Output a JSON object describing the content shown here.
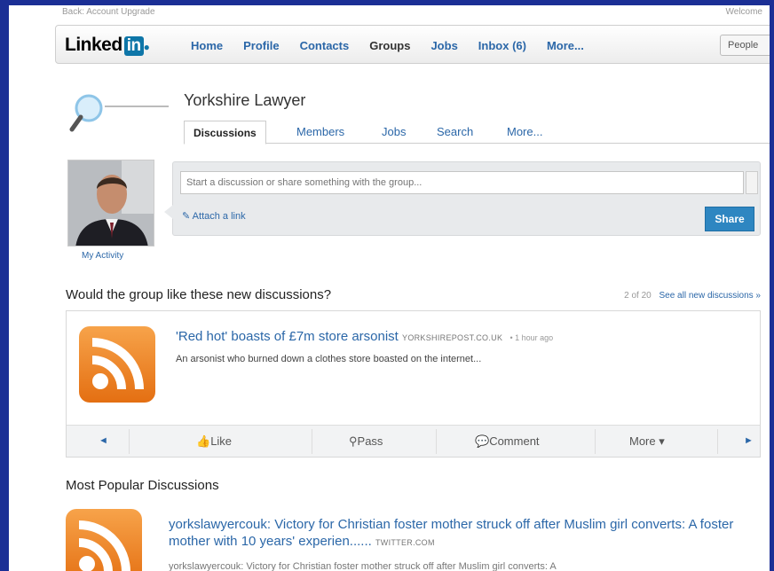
{
  "topbar": {
    "left_text": "Back: Account Upgrade",
    "right_text": "Welcome"
  },
  "nav": {
    "logo_text": "Linked",
    "logo_in": "in",
    "items": [
      "Home",
      "Profile",
      "Contacts",
      "Groups",
      "Jobs",
      "Inbox (6)",
      "More..."
    ],
    "people_button": "People"
  },
  "group": {
    "title": "Yorkshire Lawyer",
    "tabs": [
      "Discussions",
      "Members",
      "Jobs",
      "Search",
      "More..."
    ]
  },
  "composer": {
    "placeholder": "Start a discussion or share something with the group...",
    "attach_label": "Attach a link",
    "share_label": "Share",
    "my_activity": "My Activity"
  },
  "suggestions": {
    "heading": "Would the group like these new discussions?",
    "count": "2 of 20",
    "see_all": "See all new discussions »",
    "item": {
      "title": "'Red hot' boasts of £7m store arsonist",
      "source": "YORKSHIREPOST.CO.UK",
      "time": "• 1 hour ago",
      "description": "An arsonist who burned down a clothes store boasted on the internet..."
    },
    "actions": {
      "like": "Like",
      "pass": "Pass",
      "comment": "Comment",
      "more": "More ▾",
      "prev": "◄",
      "next": "►"
    }
  },
  "popular": {
    "heading": "Most Popular Discussions",
    "item": {
      "title": "yorkslawyercouk: Victory for Christian foster mother struck off after Muslim girl converts: A foster mother with 10 years' experien......",
      "source": "TWITTER.COM",
      "next_line": "yorkslawyercouk: Victory for Christian foster mother struck off after Muslim girl converts: A"
    }
  },
  "colors": {
    "frame_bg": "#1b2f95",
    "link": "#2b67a8",
    "share_btn": "#2e86c1",
    "rss_orange": "#e46f12"
  }
}
